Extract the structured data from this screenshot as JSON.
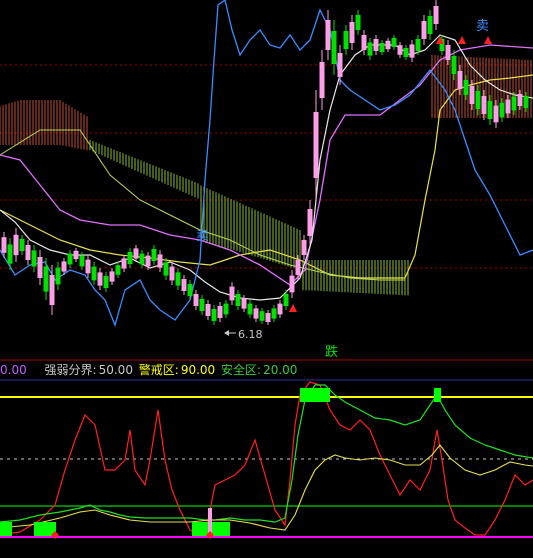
{
  "main_panel": {
    "sell_label": "卖",
    "sell_label_bottom": "卖",
    "fall_label": "跌",
    "low_price_label": "6.18"
  },
  "indicator_bar": {
    "current_value": "0.00",
    "strength_divide_label": "强弱分界:",
    "strength_divide_value": "50.00",
    "warning_zone_label": "警戒区:",
    "warning_zone_value": "90.00",
    "safe_zone_label": "安全区:",
    "safe_zone_value": "20.00"
  },
  "colors": {
    "background": "#000000",
    "candle_up": "#ff9ee8",
    "candle_down": "#00e000",
    "blue_line": "#3c8cff",
    "white_line": "#e8e8e8",
    "pink_line": "#e070ff",
    "cloud_red": "#c05030",
    "cloud_green": "#8cbc30",
    "yellow_line": "#e8e050",
    "red_osc": "#ff2020",
    "green_osc": "#20e020",
    "warning_line": "#ffff00",
    "safe_line": "#00d000",
    "zero_line": "#ff00ff",
    "grid_red": "#a00000"
  },
  "chart_data": [
    {
      "type": "candlestick",
      "series": [
        {
          "name": "",
          "values": []
        }
      ]
    },
    {
      "type": "line",
      "ylim": [
        0,
        100
      ],
      "reference_lines": [
        90,
        50,
        20
      ]
    }
  ]
}
